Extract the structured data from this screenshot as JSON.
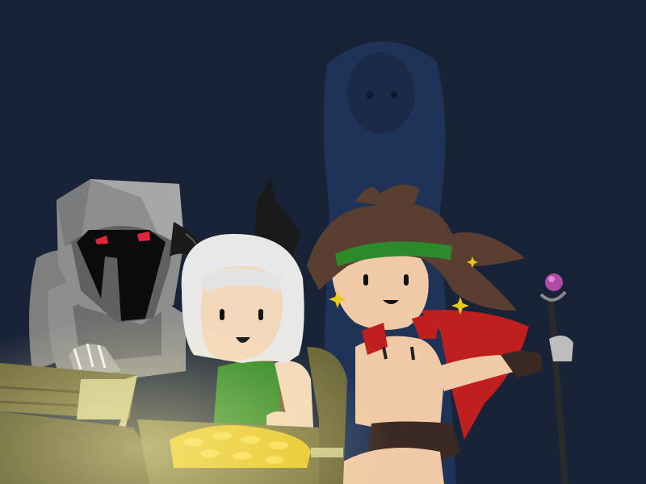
{
  "scene": {
    "background_color": "#182338",
    "shadow_figure_color": "#1f3358",
    "knight": {
      "armor_color": "#8e8e8e",
      "armor_shadow": "#5f6061",
      "visor_color": "#0b0b0b",
      "eye_color": "#e0243c"
    },
    "girl": {
      "hair_color": "#e8e8e8",
      "ear_color": "#1a1a1a",
      "skin_color": "#f3d7bb",
      "shirt_color": "#2f8a25",
      "bag_color": "#7a5b2d"
    },
    "hero": {
      "hair_color": "#5a3e31",
      "headband_color": "#2b8a2a",
      "skin_color": "#f0c9a6",
      "cape_color": "#c01f1f",
      "shorts_color": "#3b2a24",
      "sparkle_color": "#e8c81c"
    },
    "staff": {
      "shaft_color": "#2a2a2a",
      "orb_color": "#b04aa8"
    },
    "chest": {
      "wood_color": "#6f6a3a",
      "wood_light": "#c9c58a",
      "gold_color": "#e6c520"
    }
  }
}
